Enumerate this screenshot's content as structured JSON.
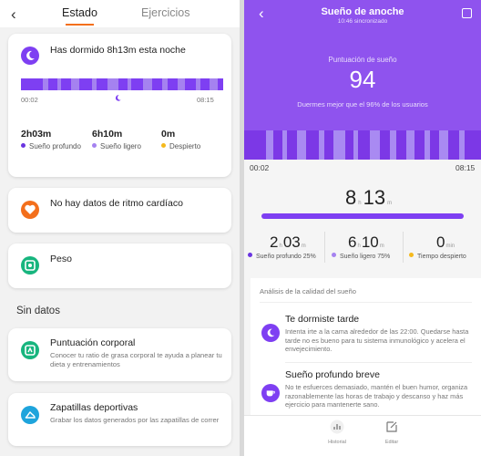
{
  "left": {
    "tabs": {
      "active": "Estado",
      "other": "Ejercicios"
    },
    "sleep_card": {
      "title": "Has dormido 8h13m esta noche",
      "start": "00:02",
      "end": "08:15",
      "stats": [
        {
          "value": "2h03m",
          "label": "Sueño profundo",
          "color": "#6a35e0"
        },
        {
          "value": "6h10m",
          "label": "Sueño ligero",
          "color": "#a582f0"
        },
        {
          "value": "0m",
          "label": "Despierto",
          "color": "#f5b91c"
        }
      ]
    },
    "heart_card": {
      "title": "No hay datos de ritmo cardíaco",
      "icon": "heart-icon",
      "color": "#f36f1c"
    },
    "weight_card": {
      "title": "Peso",
      "icon": "scale-icon",
      "color": "#17b57e"
    },
    "section_title": "Sin datos",
    "fat_card": {
      "title": "Puntuación corporal",
      "desc": "Conocer tu ratio de grasa corporal te ayuda a planear tu dieta y entrenamientos",
      "icon": "body-icon",
      "color": "#17b57e"
    },
    "shoes_card": {
      "title": "Zapatillas deportivas",
      "desc": "Grabar los datos generados por las zapatillas de correr",
      "icon": "shoe-icon",
      "color": "#1ea4dc"
    }
  },
  "right": {
    "header": {
      "title": "Sueño de anoche",
      "subtitle": "10:46 sincronizado",
      "score_label": "Puntuación de sueño",
      "score": "94",
      "score_desc": "Duermes mejor que el 96% de los usuarios",
      "color": "#8f53ee"
    },
    "times": {
      "start": "00:02",
      "end": "08:15"
    },
    "total": {
      "hours": "8",
      "h_unit": "h",
      "minutes": "13",
      "m_unit": "m"
    },
    "metrics": [
      {
        "hours": "2",
        "h_unit": "h",
        "minutes": "03",
        "m_unit": "m",
        "label": "Sueño profundo 25%",
        "color": "#6a35e0"
      },
      {
        "hours": "6",
        "h_unit": "h",
        "minutes": "10",
        "m_unit": "m",
        "label": "Sueño ligero 75%",
        "color": "#a582f0"
      },
      {
        "minutes": "0",
        "m_unit": "min",
        "label": "Tiempo despierto",
        "color": "#f5b91c"
      }
    ],
    "analysis": {
      "header": "Análisis de la calidad del sueño",
      "items": [
        {
          "title": "Te dormiste tarde",
          "desc": "Intenta irte a la cama alrededor de las 22:00. Quedarse hasta tarde no es bueno para tu sistema inmunológico y acelera el envejecimiento.",
          "icon": "moon-icon"
        },
        {
          "title": "Sueño profundo breve",
          "desc": "No te esfuerces demasiado, mantén el buen humor, organiza razonablemente las horas de trabajo y descanso y haz más ejercicio para mantenerte sano.",
          "icon": "cup-icon"
        }
      ]
    },
    "nav": {
      "history": "Historial",
      "edit": "Editar"
    }
  }
}
